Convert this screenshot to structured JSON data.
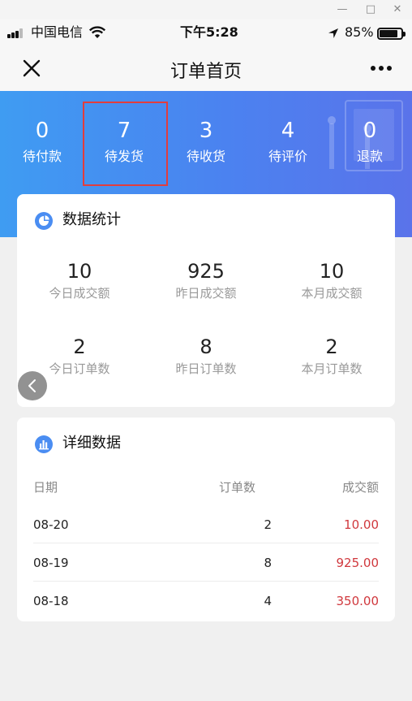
{
  "status": {
    "carrier": "中国电信",
    "time": "下午5:28",
    "battery": "85%",
    "battery_level": 0.85
  },
  "nav": {
    "title": "订单首页",
    "close_icon": "close-icon",
    "more_icon": "more-icon"
  },
  "summary": [
    {
      "value": "0",
      "label": "待付款"
    },
    {
      "value": "7",
      "label": "待发货"
    },
    {
      "value": "3",
      "label": "待收货"
    },
    {
      "value": "4",
      "label": "待评价"
    },
    {
      "value": "0",
      "label": "退款"
    }
  ],
  "stats": {
    "title": "数据统计",
    "icon": "pie-chart-icon",
    "items": [
      {
        "value": "10",
        "label": "今日成交额"
      },
      {
        "value": "925",
        "label": "昨日成交额"
      },
      {
        "value": "10",
        "label": "本月成交额"
      },
      {
        "value": "2",
        "label": "今日订单数"
      },
      {
        "value": "8",
        "label": "昨日订单数"
      },
      {
        "value": "2",
        "label": "本月订单数"
      }
    ]
  },
  "detail": {
    "title": "详细数据",
    "icon": "bar-chart-icon",
    "columns": {
      "date": "日期",
      "orders": "订单数",
      "amount": "成交额"
    },
    "rows": [
      {
        "date": "08-20",
        "orders": "2",
        "amount": "10.00"
      },
      {
        "date": "08-19",
        "orders": "8",
        "amount": "925.00"
      },
      {
        "date": "08-18",
        "orders": "4",
        "amount": "350.00"
      }
    ]
  },
  "colors": {
    "banner_start": "#3f9cf2",
    "banner_end": "#5a73ea",
    "accent": "#4a8df2",
    "amount": "#d0383d",
    "highlight": "#e23d3d"
  }
}
